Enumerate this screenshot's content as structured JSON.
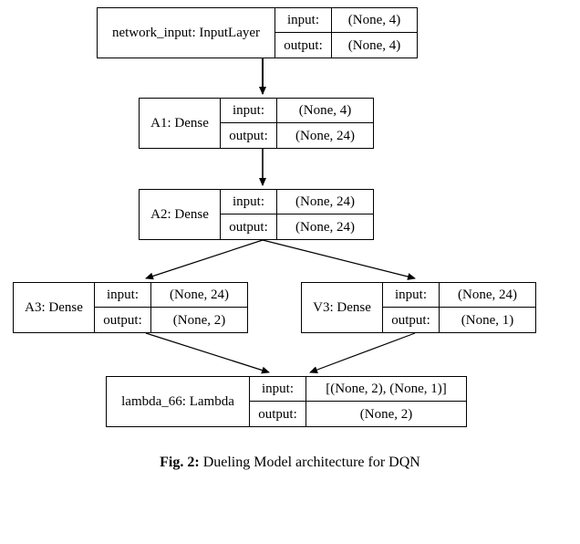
{
  "nodes": {
    "input": {
      "name": "network_input: InputLayer",
      "io_in_label": "input:",
      "io_out_label": "output:",
      "shape_in": "(None, 4)",
      "shape_out": "(None, 4)"
    },
    "a1": {
      "name": "A1: Dense",
      "io_in_label": "input:",
      "io_out_label": "output:",
      "shape_in": "(None, 4)",
      "shape_out": "(None, 24)"
    },
    "a2": {
      "name": "A2: Dense",
      "io_in_label": "input:",
      "io_out_label": "output:",
      "shape_in": "(None, 24)",
      "shape_out": "(None, 24)"
    },
    "a3": {
      "name": "A3: Dense",
      "io_in_label": "input:",
      "io_out_label": "output:",
      "shape_in": "(None, 24)",
      "shape_out": "(None, 2)"
    },
    "v3": {
      "name": "V3: Dense",
      "io_in_label": "input:",
      "io_out_label": "output:",
      "shape_in": "(None, 24)",
      "shape_out": "(None, 1)"
    },
    "lambda": {
      "name": "lambda_66: Lambda",
      "io_in_label": "input:",
      "io_out_label": "output:",
      "shape_in": "[(None, 2), (None, 1)]",
      "shape_out": "(None, 2)"
    }
  },
  "caption": {
    "label": "Fig. 2:",
    "text": " Dueling Model architecture for DQN"
  }
}
